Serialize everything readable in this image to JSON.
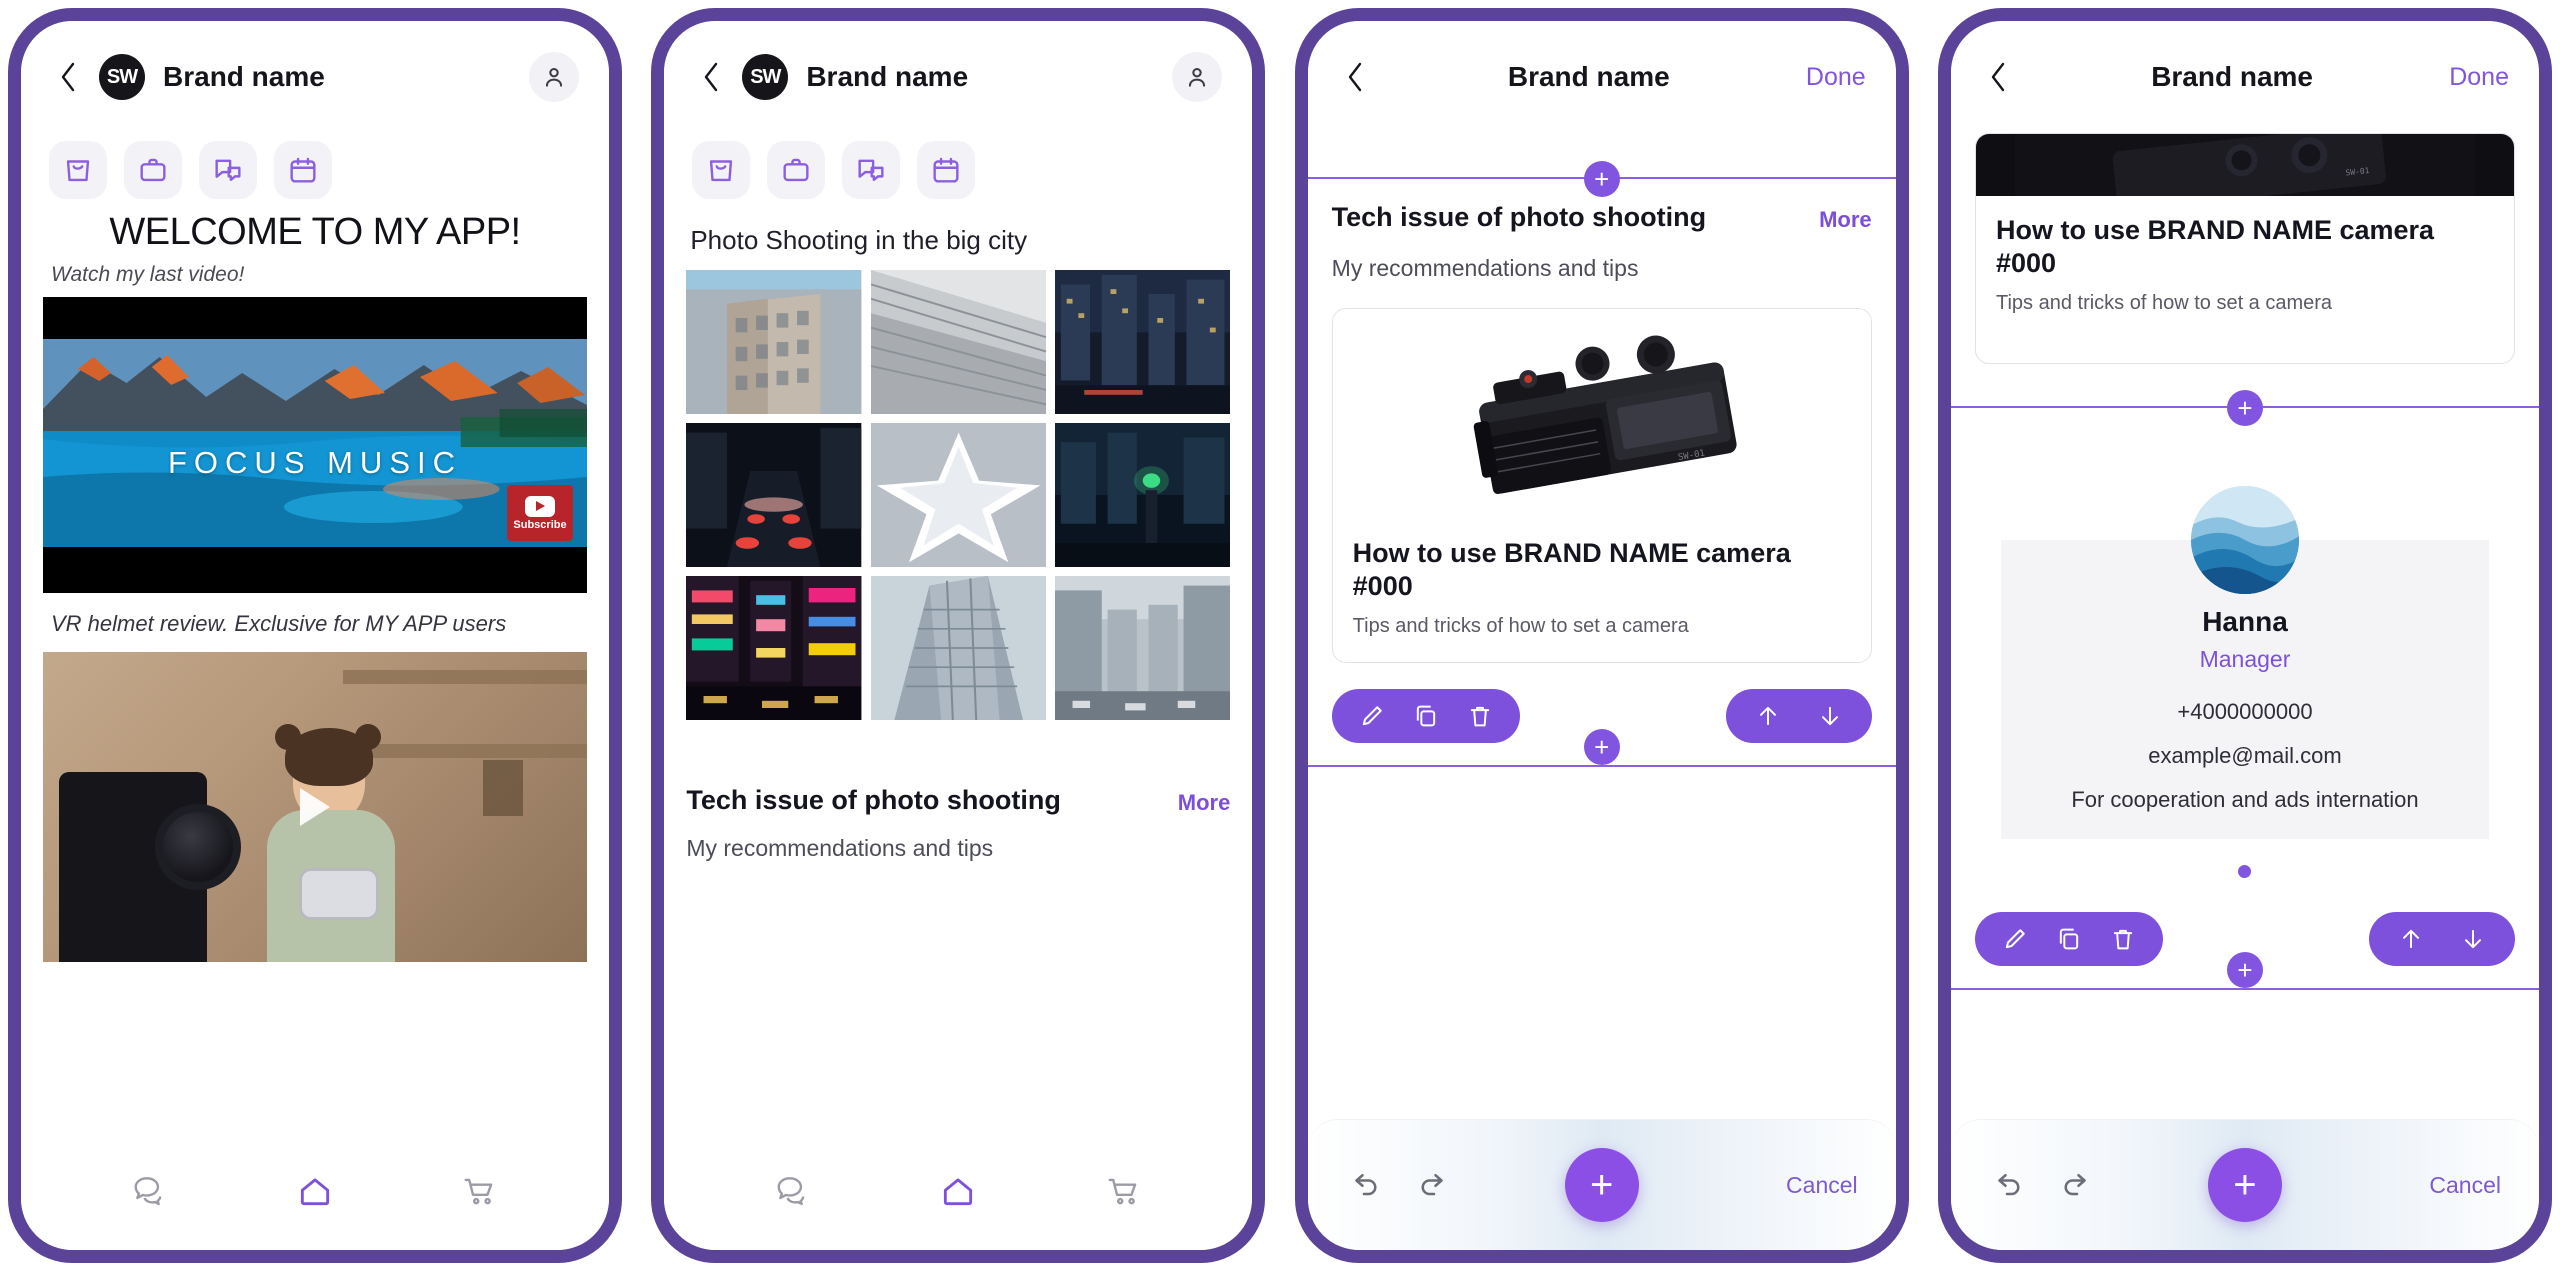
{
  "theme": {
    "frame_purple": "#5b4399",
    "accent_purple": "#8255e0",
    "pill_purple": "#7d51dc",
    "link_purple": "#7d4fd8",
    "text_dark": "#15151f",
    "text_muted": "#4d4d5a",
    "chip_bg": "#f3f3f7"
  },
  "screens": [
    {
      "id": "home",
      "topbar": {
        "back_icon": "chevron-left-icon",
        "avatar_initials": "SW",
        "title": "Brand name",
        "profile_icon": "person-icon"
      },
      "categories": [
        {
          "icon": "shopping-bag-icon",
          "label": "Shop"
        },
        {
          "icon": "briefcase-icon",
          "label": "Work"
        },
        {
          "icon": "chat-bubbles-icon",
          "label": "Chat"
        },
        {
          "icon": "calendar-icon",
          "label": "Calendar"
        }
      ],
      "hero": {
        "title": "WELCOME TO MY APP!",
        "subtitle": "Watch my last video!"
      },
      "video1": {
        "overlay_text": "FOCUS MUSIC",
        "subscribe_label": "Subscribe",
        "play_icon": "youtube-play-icon"
      },
      "caption": "VR helmet review. Exclusive for MY APP users",
      "video2": {
        "play_icon": "play-triangle-icon"
      },
      "bottomnav": [
        {
          "icon": "chat-bubbles-icon",
          "label": "Messages",
          "active": false
        },
        {
          "icon": "home-icon",
          "label": "Home",
          "active": true
        },
        {
          "icon": "cart-icon",
          "label": "Cart",
          "active": false
        }
      ]
    },
    {
      "id": "gallery",
      "topbar": {
        "back_icon": "chevron-left-icon",
        "avatar_initials": "SW",
        "title": "Brand name",
        "profile_icon": "person-icon"
      },
      "categories": [
        {
          "icon": "shopping-bag-icon",
          "label": "Shop"
        },
        {
          "icon": "briefcase-icon",
          "label": "Work"
        },
        {
          "icon": "chat-bubbles-icon",
          "label": "Chat"
        },
        {
          "icon": "calendar-icon",
          "label": "Calendar"
        }
      ],
      "grid_title": "Photo Shooting in the big city",
      "photos": [
        {
          "alt": "flatiron-building"
        },
        {
          "alt": "modern-glass-facade"
        },
        {
          "alt": "night-city-street"
        },
        {
          "alt": "red-light-traffic-night"
        },
        {
          "alt": "white-abstract-star"
        },
        {
          "alt": "green-traffic-light-night"
        },
        {
          "alt": "times-square-neon"
        },
        {
          "alt": "glass-skyscraper-up"
        },
        {
          "alt": "downtown-avenue"
        }
      ],
      "section": {
        "title": "Tech issue of photo shooting",
        "more_label": "More",
        "subtitle": "My recommendations and tips"
      },
      "bottomnav": [
        {
          "icon": "chat-bubbles-icon",
          "label": "Messages",
          "active": false
        },
        {
          "icon": "home-icon",
          "label": "Home",
          "active": true
        },
        {
          "icon": "cart-icon",
          "label": "Cart",
          "active": false
        }
      ]
    },
    {
      "id": "editor-block",
      "topbar": {
        "back_icon": "chevron-left-icon",
        "title": "Brand name",
        "done_label": "Done"
      },
      "block": {
        "title": "Tech issue of photo shooting",
        "more_label": "More",
        "subtitle": "My recommendations and tips",
        "card": {
          "image_alt": "black-mirrorless-camera",
          "title": "How to use BRAND NAME camera #000",
          "subtitle": "Tips and tricks of how to set a camera"
        },
        "tools_left": [
          {
            "icon": "pencil-icon",
            "label": "Edit"
          },
          {
            "icon": "duplicate-icon",
            "label": "Duplicate"
          },
          {
            "icon": "trash-icon",
            "label": "Delete"
          }
        ],
        "tools_right": [
          {
            "icon": "arrow-up-icon",
            "label": "Move up"
          },
          {
            "icon": "arrow-down-icon",
            "label": "Move down"
          }
        ],
        "add_node_label": "+"
      },
      "footer": {
        "undo_icon": "undo-icon",
        "redo_icon": "redo-icon",
        "fab_label": "+",
        "cancel_label": "Cancel"
      }
    },
    {
      "id": "editor-contact",
      "topbar": {
        "back_icon": "chevron-left-icon",
        "title": "Brand name",
        "done_label": "Done"
      },
      "top_card": {
        "image_alt": "black-mirrorless-camera-cropped",
        "title": "How to use BRAND NAME camera #000",
        "subtitle": "Tips and tricks of how to set a camera"
      },
      "contact": {
        "avatar_alt": "mountain-landscape-avatar",
        "name": "Hanna",
        "role": "Manager",
        "phone": "+4000000000",
        "email": "example@mail.com",
        "note": "For cooperation and ads internation",
        "carousel_dots": 1
      },
      "tools_left": [
        {
          "icon": "pencil-icon",
          "label": "Edit"
        },
        {
          "icon": "duplicate-icon",
          "label": "Duplicate"
        },
        {
          "icon": "trash-icon",
          "label": "Delete"
        }
      ],
      "tools_right": [
        {
          "icon": "arrow-up-icon",
          "label": "Move up"
        },
        {
          "icon": "arrow-down-icon",
          "label": "Move down"
        }
      ],
      "add_node_label": "+",
      "footer": {
        "undo_icon": "undo-icon",
        "redo_icon": "redo-icon",
        "fab_label": "+",
        "cancel_label": "Cancel"
      }
    }
  ]
}
